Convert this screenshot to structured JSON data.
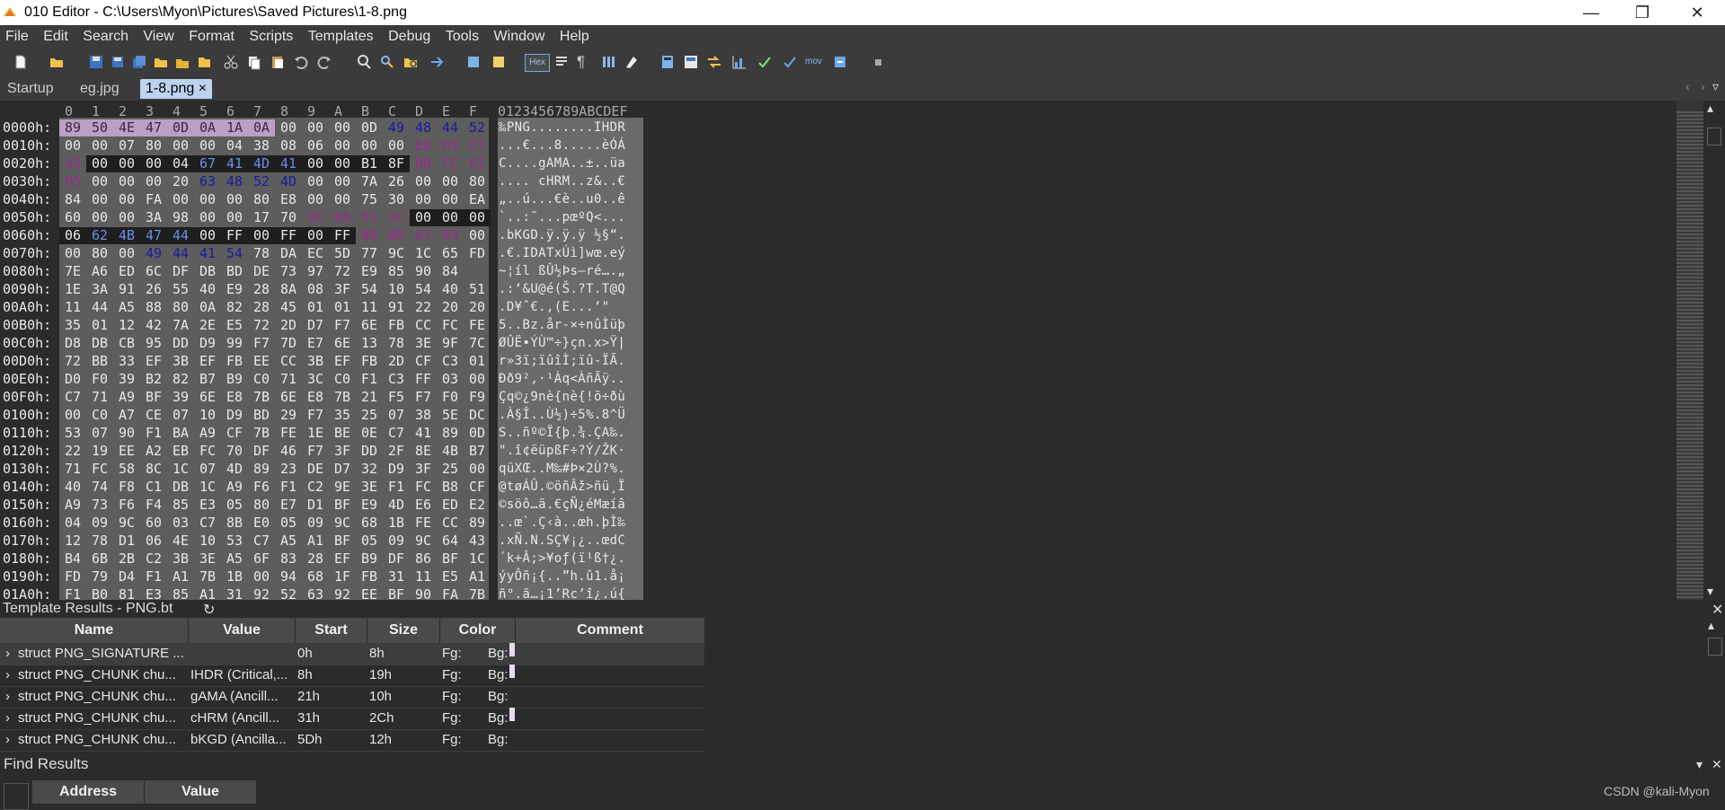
{
  "window": {
    "title": "010 Editor - C:\\Users\\Myon\\Pictures\\Saved Pictures\\1-8.png",
    "minimize": "—",
    "restore": "❐",
    "close": "✕"
  },
  "menu": [
    "File",
    "Edit",
    "Search",
    "View",
    "Format",
    "Scripts",
    "Templates",
    "Debug",
    "Tools",
    "Window",
    "Help"
  ],
  "toolbar": {
    "hex_label": "Hex",
    "mov_label": "mov"
  },
  "tabs": [
    {
      "label": "Startup",
      "active": false
    },
    {
      "label": "eg.jpg",
      "active": false
    },
    {
      "label": "1-8.png",
      "active": true,
      "close": "×"
    }
  ],
  "hex": {
    "column_headers": [
      "0",
      "1",
      "2",
      "3",
      "4",
      "5",
      "6",
      "7",
      "8",
      "9",
      "A",
      "B",
      "C",
      "D",
      "E",
      "F"
    ],
    "ascii_header": "0123456789ABCDEF",
    "rows": [
      {
        "addr": "0000h:",
        "bytes": [
          "89",
          "50",
          "4E",
          "47",
          "0D",
          "0A",
          "1A",
          "0A",
          "00",
          "00",
          "00",
          "0D",
          "49",
          "48",
          "44",
          "52"
        ],
        "ascii": "‰PNG........IHDR"
      },
      {
        "addr": "0010h:",
        "bytes": [
          "00",
          "00",
          "07",
          "80",
          "00",
          "00",
          "04",
          "38",
          "08",
          "06",
          "00",
          "00",
          "00",
          "E8",
          "D3",
          "C1"
        ],
        "ascii": "...€...8.....èÓÁ"
      },
      {
        "addr": "0020h:",
        "bytes": [
          "43",
          "00",
          "00",
          "00",
          "04",
          "67",
          "41",
          "4D",
          "41",
          "00",
          "00",
          "B1",
          "8F",
          "0B",
          "FC",
          "61"
        ],
        "ascii": "C....gAMA..±..üa"
      },
      {
        "addr": "0030h:",
        "bytes": [
          "05",
          "00",
          "00",
          "00",
          "20",
          "63",
          "48",
          "52",
          "4D",
          "00",
          "00",
          "7A",
          "26",
          "00",
          "00",
          "80"
        ],
        "ascii": ".... cHRM..z&..€"
      },
      {
        "addr": "0040h:",
        "bytes": [
          "84",
          "00",
          "00",
          "FA",
          "00",
          "00",
          "00",
          "80",
          "E8",
          "00",
          "00",
          "75",
          "30",
          "00",
          "00",
          "EA"
        ],
        "ascii": "„..ú...€è..u0..ê"
      },
      {
        "addr": "0050h:",
        "bytes": [
          "60",
          "00",
          "00",
          "3A",
          "98",
          "00",
          "00",
          "17",
          "70",
          "9C",
          "BA",
          "51",
          "3C",
          "00",
          "00",
          "00"
        ],
        "ascii": "`..:˜...pœºQ<..."
      },
      {
        "addr": "0060h:",
        "bytes": [
          "06",
          "62",
          "4B",
          "47",
          "44",
          "00",
          "FF",
          "00",
          "FF",
          "00",
          "FF",
          "A0",
          "BD",
          "A7",
          "93",
          "00"
        ],
        "ascii": ".bKGD.ÿ.ÿ.ÿ ½§“."
      },
      {
        "addr": "0070h:",
        "bytes": [
          "00",
          "80",
          "00",
          "49",
          "44",
          "41",
          "54",
          "78",
          "DA",
          "EC",
          "5D",
          "77",
          "9C",
          "1C",
          "65",
          "FD"
        ],
        "ascii": ".€.IDATxÚì]wœ.eý"
      },
      {
        "addr": "0080h:",
        "bytes": [
          "7E",
          "A6",
          "ED",
          "6C",
          "DF",
          "DB",
          "BD",
          "DE",
          "73",
          "97",
          "72",
          "E9",
          "85",
          "90",
          "84"
        ],
        "ascii": "~¦íl ßÛ½Þs—ré….„"
      },
      {
        "addr": "0090h:",
        "bytes": [
          "1E",
          "3A",
          "91",
          "26",
          "55",
          "40",
          "E9",
          "28",
          "8A",
          "08",
          "3F",
          "54",
          "10",
          "54",
          "40",
          "51"
        ],
        "ascii": ".:‘&U@é(Š.?T.T@Q"
      },
      {
        "addr": "00A0h:",
        "bytes": [
          "11",
          "44",
          "A5",
          "88",
          "80",
          "0A",
          "82",
          "28",
          "45",
          "01",
          "01",
          "11",
          "91",
          "22",
          "20",
          "20"
        ],
        "ascii": ".D¥ˆ€.‚(E...‘\"  "
      },
      {
        "addr": "00B0h:",
        "bytes": [
          "35",
          "01",
          "12",
          "42",
          "7A",
          "2E",
          "E5",
          "72",
          "2D",
          "D7",
          "F7",
          "6E",
          "FB",
          "CC",
          "FC",
          "FE"
        ],
        "ascii": "5..Bz.år-×÷nûÌüþ"
      },
      {
        "addr": "00C0h:",
        "bytes": [
          "D8",
          "DB",
          "CB",
          "95",
          "DD",
          "D9",
          "99",
          "F7",
          "7D",
          "E7",
          "6E",
          "13",
          "78",
          "3E",
          "9F",
          "7C"
        ],
        "ascii": "ØÛË•ÝÙ™÷}çn.x>Ÿ|"
      },
      {
        "addr": "00D0h:",
        "bytes": [
          "72",
          "BB",
          "33",
          "EF",
          "3B",
          "EF",
          "FB",
          "EE",
          "CC",
          "3B",
          "EF",
          "FB",
          "2D",
          "CF",
          "C3",
          "01"
        ],
        "ascii": "r»3ï;ïûîÌ;ïû-ÏÃ."
      },
      {
        "addr": "00E0h:",
        "bytes": [
          "D0",
          "F0",
          "39",
          "B2",
          "82",
          "B7",
          "B9",
          "C0",
          "71",
          "3C",
          "C0",
          "F1",
          "C3",
          "FF",
          "03",
          "00"
        ],
        "ascii": "Ðð9²‚·¹Àq<ÀñÃÿ.."
      },
      {
        "addr": "00F0h:",
        "bytes": [
          "C7",
          "71",
          "A9",
          "BF",
          "39",
          "6E",
          "E8",
          "7B",
          "6E",
          "E8",
          "7B",
          "21",
          "F5",
          "F7",
          "F0",
          "F9"
        ],
        "ascii": "Çq©¿9nè{nè{!õ÷ðù"
      },
      {
        "addr": "0100h:",
        "bytes": [
          "00",
          "C0",
          "A7",
          "CE",
          "07",
          "10",
          "D9",
          "BD",
          "29",
          "F7",
          "35",
          "25",
          "07",
          "38",
          "5E",
          "DC"
        ],
        "ascii": ".À§Î..Ù½)÷5%.8^Ü"
      },
      {
        "addr": "0110h:",
        "bytes": [
          "53",
          "07",
          "90",
          "F1",
          "BA",
          "A9",
          "CF",
          "7B",
          "FE",
          "1E",
          "BE",
          "0E",
          "C7",
          "41",
          "89",
          "0D"
        ],
        "ascii": "S..ñº©Ï{þ.¾.ÇA‰."
      },
      {
        "addr": "0120h:",
        "bytes": [
          "22",
          "19",
          "EE",
          "A2",
          "EB",
          "FC",
          "70",
          "DF",
          "46",
          "F7",
          "3F",
          "DD",
          "2F",
          "8E",
          "4B",
          "B7"
        ],
        "ascii": "\".î¢ëüpßF÷?Ý/ŽK·"
      },
      {
        "addr": "0130h:",
        "bytes": [
          "71",
          "FC",
          "58",
          "8C",
          "1C",
          "07",
          "4D",
          "89",
          "23",
          "DE",
          "D7",
          "32",
          "D9",
          "3F",
          "25",
          "00"
        ],
        "ascii": "qüXŒ..M‰#Þ×2Ù?%."
      },
      {
        "addr": "0140h:",
        "bytes": [
          "40",
          "74",
          "F8",
          "C1",
          "DB",
          "1C",
          "A9",
          "F6",
          "F1",
          "C2",
          "9E",
          "3E",
          "F1",
          "FC",
          "B8",
          "CF"
        ],
        "ascii": "@tøÁÛ.©öñÂž>ñü¸Ï"
      },
      {
        "addr": "0150h:",
        "bytes": [
          "A9",
          "73",
          "F6",
          "F4",
          "85",
          "E3",
          "05",
          "80",
          "E7",
          "D1",
          "BF",
          "E9",
          "4D",
          "E6",
          "ED",
          "E2"
        ],
        "ascii": "©söô…ã.€çÑ¿éMæíâ"
      },
      {
        "addr": "0160h:",
        "bytes": [
          "04",
          "09",
          "9C",
          "60",
          "03",
          "C7",
          "8B",
          "E0",
          "05",
          "09",
          "9C",
          "68",
          "1B",
          "FE",
          "CC",
          "89"
        ],
        "ascii": "..œ`.Ç‹à..œh.þÌ‰"
      },
      {
        "addr": "0170h:",
        "bytes": [
          "12",
          "78",
          "D1",
          "06",
          "4E",
          "10",
          "53",
          "C7",
          "A5",
          "A1",
          "BF",
          "05",
          "09",
          "9C",
          "64",
          "43"
        ],
        "ascii": ".xÑ.N.SÇ¥¡¿..œdC"
      },
      {
        "addr": "0180h:",
        "bytes": [
          "B4",
          "6B",
          "2B",
          "C2",
          "3B",
          "3E",
          "A5",
          "6F",
          "83",
          "28",
          "EF",
          "B9",
          "DF",
          "86",
          "BF",
          "1C"
        ],
        "ascii": "´k+Â;>¥oƒ(ï¹ß†¿."
      },
      {
        "addr": "0190h:",
        "bytes": [
          "FD",
          "79",
          "D4",
          "F1",
          "A1",
          "7B",
          "1B",
          "00",
          "94",
          "68",
          "1F",
          "FB",
          "31",
          "11",
          "E5",
          "A1"
        ],
        "ascii": "ýyÔñ¡{..”h.û1.å¡"
      },
      {
        "addr": "01A0h:",
        "bytes": [
          "F1",
          "B0",
          "81",
          "E3",
          "85",
          "A1",
          "31",
          "92",
          "52",
          "63",
          "92",
          "EE",
          "BF",
          "90",
          "FA",
          "7B"
        ],
        "ascii": "ñ°.ã…¡1’Rc’î¿.ú{"
      }
    ]
  },
  "template_results": {
    "title": "Template Results - PNG.bt",
    "refresh_icon": "↻",
    "columns": [
      "Name",
      "Value",
      "Start",
      "Size",
      "Color",
      "Comment"
    ],
    "rows": [
      {
        "expander": "›",
        "name": "struct PNG_SIGNATURE ...",
        "value": "",
        "start": "0h",
        "size": "8h",
        "fg": "Fg:",
        "bg": "Bg:"
      },
      {
        "expander": "›",
        "name": "struct PNG_CHUNK chu...",
        "value": "IHDR  (Critical,...",
        "start": "8h",
        "size": "19h",
        "fg": "Fg:",
        "bg": "Bg:"
      },
      {
        "expander": "›",
        "name": "struct PNG_CHUNK chu...",
        "value": "gAMA  (Ancill...",
        "start": "21h",
        "size": "10h",
        "fg": "Fg:",
        "bg": "Bg:"
      },
      {
        "expander": "›",
        "name": "struct PNG_CHUNK chu...",
        "value": "cHRM  (Ancill...",
        "start": "31h",
        "size": "2Ch",
        "fg": "Fg:",
        "bg": "Bg:"
      },
      {
        "expander": "›",
        "name": "struct PNG_CHUNK chu...",
        "value": "bKGD  (Ancilla...",
        "start": "5Dh",
        "size": "12h",
        "fg": "Fg:",
        "bg": "Bg:"
      }
    ]
  },
  "find_results": {
    "title": "Find Results",
    "columns": [
      "Address",
      "Value"
    ]
  },
  "watermark": "CSDN @kali-Myon",
  "panel_controls": {
    "dropdown": "▾",
    "close": "✕"
  },
  "colors": {
    "sig_bg": "#b9a0c4",
    "chunk_text": "#1a1aa0",
    "crc_text": "#9a2a8a",
    "sel_bg": "#1e1e1e"
  }
}
